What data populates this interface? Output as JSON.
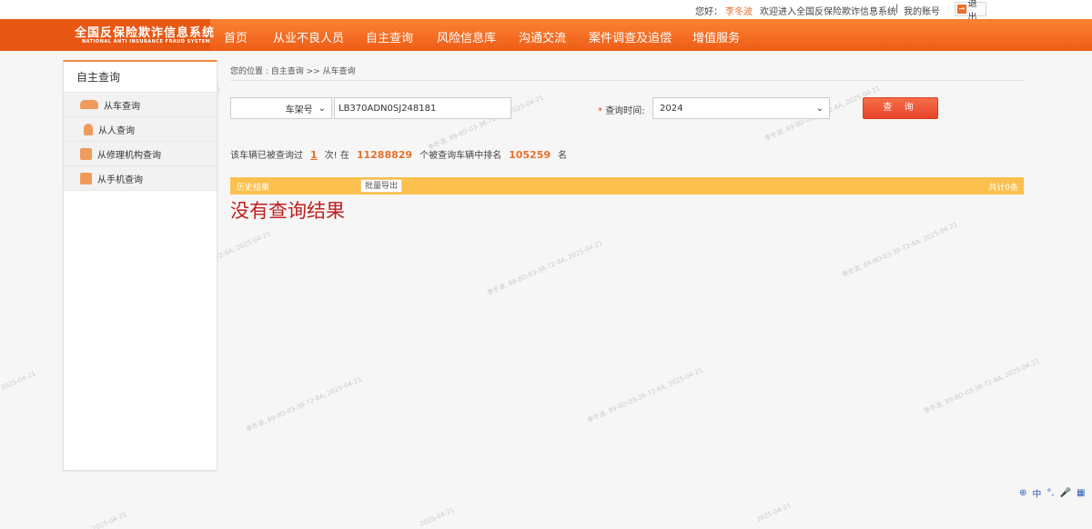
{
  "topbar": {
    "greeting": "您好：",
    "username": "李冬波",
    "welcome": "欢迎进入全国反保险欺诈信息系统",
    "divider": "|",
    "my_account": "我的账号",
    "logout": "退出"
  },
  "logo": {
    "title_cn": "全国反保险欺诈信息系统",
    "title_en": "NATIONAL ANTI INSURANCE FRAUD SYSTEM"
  },
  "nav": [
    "首页",
    "从业不良人员",
    "自主查询",
    "风险信息库",
    "沟通交流",
    "案件调查及追偿",
    "增值服务"
  ],
  "sidebar": {
    "title": "自主查询",
    "items": [
      {
        "label": "从车查询",
        "icon": "car-icon"
      },
      {
        "label": "从人查询",
        "icon": "person-icon"
      },
      {
        "label": "从修理机构查询",
        "icon": "repair-shop-icon"
      },
      {
        "label": "从手机查询",
        "icon": "phone-icon"
      }
    ]
  },
  "breadcrumb": "您的位置 : 自主查询 >> 从车查询",
  "search": {
    "type_label": "车架号",
    "vin_value": "LB370ADN0SJ248181",
    "time_required_mark": "*",
    "time_label": "查询时间:",
    "year_value": "2024",
    "query_button": "查 询"
  },
  "stats": {
    "prefix": "该车辆已被查询过",
    "count": "1",
    "times": "次! 在",
    "total_vehicles": "11288829",
    "middle": "个被查询车辆中排名",
    "rank": "105259",
    "suffix": "名"
  },
  "results": {
    "tab_label": "历史结果",
    "export_button": "批量导出",
    "total_label": "共计0条",
    "empty_message": "没有查询结果"
  },
  "watermark": "李冬波, 89-8D-03-38-72-8A, 2025-04-21",
  "watermark_fragment": "2025-04-21",
  "tray": {
    "ime_label": "中",
    "punct": "°,",
    "mic": "🎤",
    "grid": "▦"
  },
  "colors": {
    "nav_orange": "#f37333",
    "accent_red": "#e8442a",
    "result_bar": "#fbc04e",
    "empty_red": "#c01f1f"
  }
}
